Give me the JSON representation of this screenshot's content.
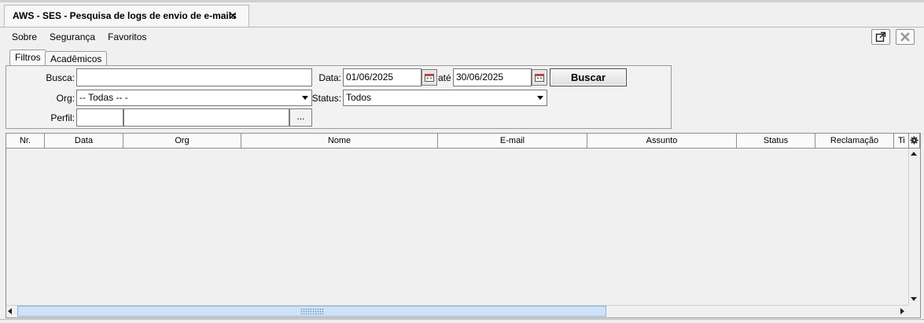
{
  "window_tab": {
    "title": "AWS - SES - Pesquisa de logs de envio de e-mails",
    "close": "✕"
  },
  "menu": [
    "Sobre",
    "Segurança",
    "Favoritos"
  ],
  "tabs": [
    "Filtros",
    "Acadêmicos"
  ],
  "filters": {
    "busca_label": "Busca:",
    "busca_value": "",
    "data_label": "Data:",
    "data_from": "01/06/2025",
    "ate_label": "até",
    "data_to": "30/06/2025",
    "buscar_label": "Buscar",
    "org_label": "Org:",
    "org_value": "-- Todas -- -",
    "status_label": "Status:",
    "status_value": "Todos",
    "perfil_label": "Perfil:",
    "perfil_code": "",
    "perfil_name": "",
    "dots_label": "..."
  },
  "table": {
    "columns": [
      "Nr.",
      "Data",
      "Org",
      "Nome",
      "E-mail",
      "Assunto",
      "Status",
      "Reclamação",
      "Ti"
    ],
    "rows": []
  },
  "icons": {
    "popout": "popout-icon",
    "close_disabled": "close-icon",
    "calendar": "calendar-icon",
    "settings": "gear-icon"
  }
}
